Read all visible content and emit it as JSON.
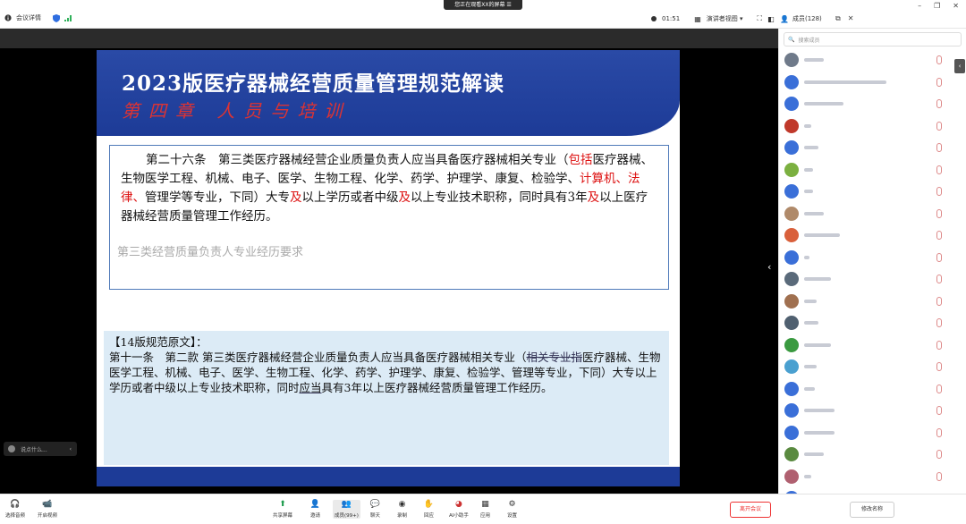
{
  "topbar": {
    "meeting_info": "会议详情",
    "share_banner": "您正在观看XX的屏幕",
    "timer": "01:51",
    "view_mode": "演讲者视图",
    "members_label": "成员(128)"
  },
  "slide": {
    "title": "2023版医疗器械经营质量管理规范解读",
    "chapter": "第四章  人员与培训",
    "box1": {
      "t1": "第二十六条　第三类医疗器械经营企业质量负责人应当具备医疗器械相关专业（",
      "t2": "包括",
      "t3": "医疗器械、生物医学工程、机械、电子、医学、生物工程、化学、药学、护理学、康复、检验学、",
      "t4": "计算机、法律、",
      "t5": "管理学等专业，下同）大专",
      "t6": "及",
      "t7": "以上学历或者中级",
      "t8": "及",
      "t9": "以上专业技术职称，同时具有3年",
      "t10": "及",
      "t11": "以上医疗器械经营质量管理工作经历。",
      "hint": "第三类经营质量负责人专业经历要求"
    },
    "box2": {
      "heading": "【14版规范原文】：",
      "t1": "第十一条　第二款 第三类医疗器械经营企业质量负责人应当具备医疗器械相关专业（",
      "t2": "相关专业指",
      "t3": "医疗器械、生物医学工程、机械、电子、医学、生物工程、化学、药学、护理学、康复、检验学、管理等专业，下同）大专以上学历或者中级以上专业技术职称，同时",
      "t4": "应当",
      "t5": "具有3年以上医疗器械经营质量管理工作经历。"
    }
  },
  "chat_pill": "说点什么...",
  "sidebar": {
    "search_placeholder": "搜索成员",
    "members": [
      {
        "color": "#6f7a8a"
      },
      {
        "color": "#3a6fd8"
      },
      {
        "color": "#3a6fd8"
      },
      {
        "color": "#c0392b"
      },
      {
        "color": "#3a6fd8"
      },
      {
        "color": "#7bb040"
      },
      {
        "color": "#3a6fd8"
      },
      {
        "color": "#b08a6a"
      },
      {
        "color": "#d9603b"
      },
      {
        "color": "#3a6fd8"
      },
      {
        "color": "#5a6a7a"
      },
      {
        "color": "#a07050"
      },
      {
        "color": "#506070"
      },
      {
        "color": "#3a9a40"
      },
      {
        "color": "#4aa0d0"
      },
      {
        "color": "#3a6fd8"
      },
      {
        "color": "#3a6fd8"
      },
      {
        "color": "#3a6fd8"
      },
      {
        "color": "#5a8a40"
      },
      {
        "color": "#b06070"
      },
      {
        "color": "#3a6fd8"
      }
    ]
  },
  "toolbar": {
    "mic": "选择音频",
    "video": "开启视频",
    "share": "共享屏幕",
    "invite": "邀请",
    "members": "成员(99+)",
    "chat": "聊天",
    "record": "录制",
    "reply": "回应",
    "ai": "AI小助手",
    "apps": "应用",
    "settings": "设置",
    "leave": "离开会议",
    "rename": "修改名称"
  }
}
